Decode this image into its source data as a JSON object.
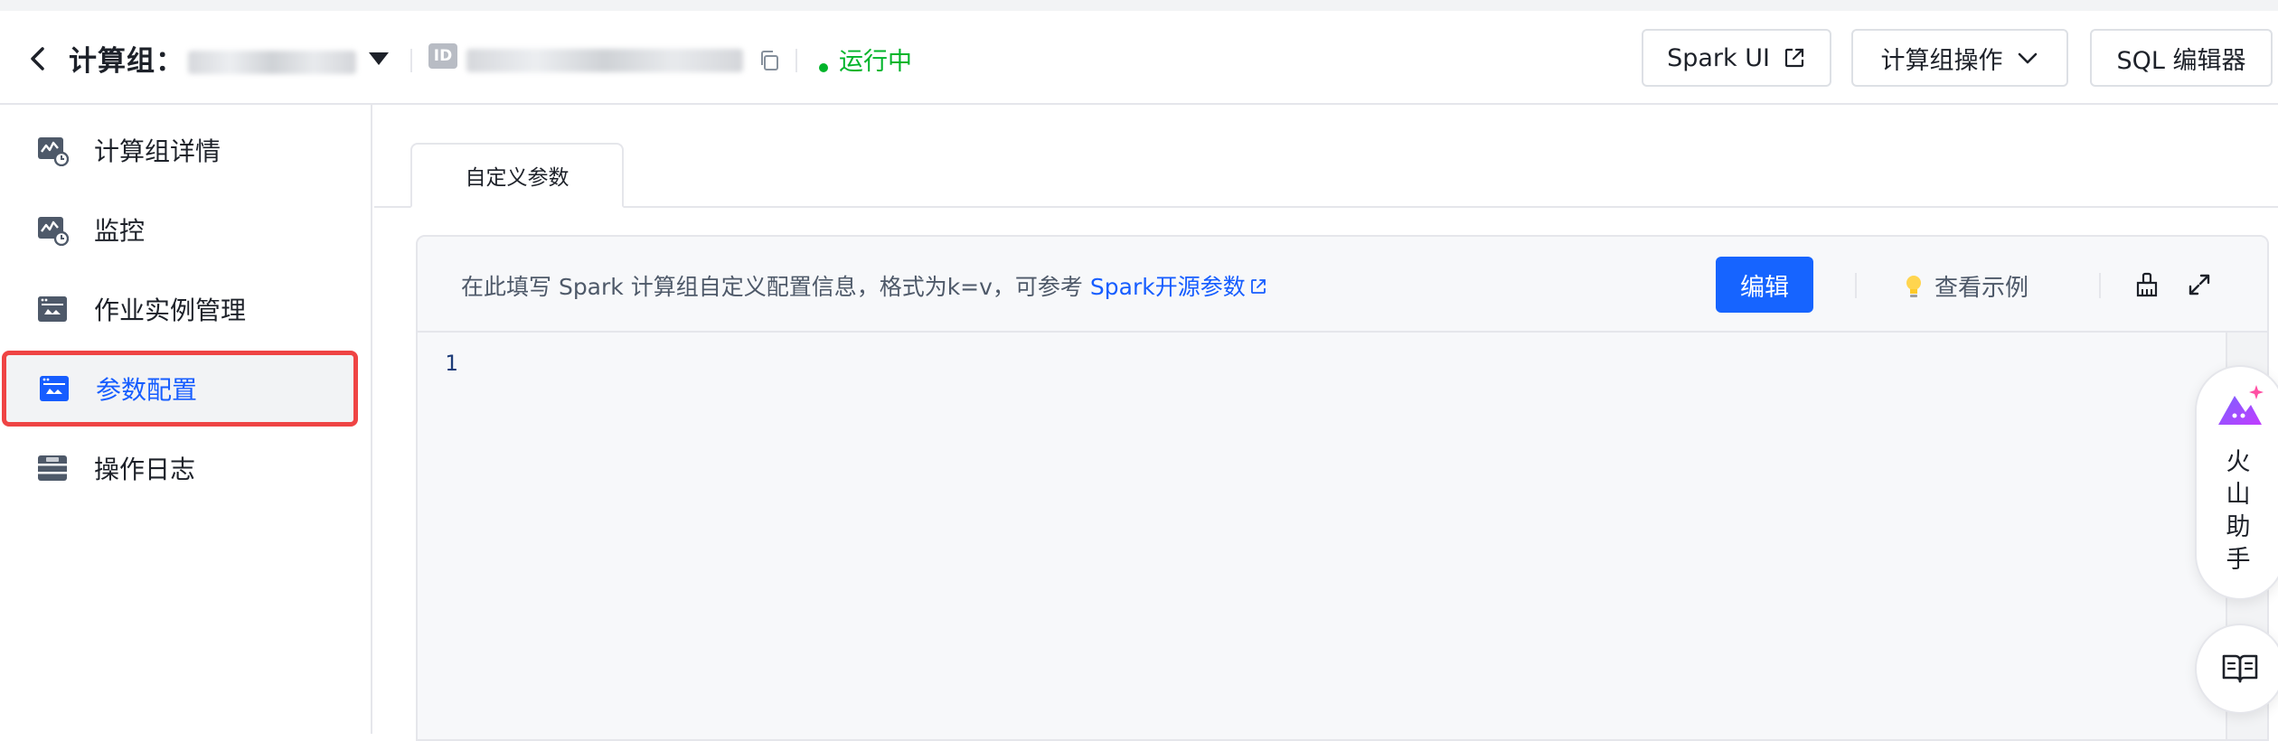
{
  "header": {
    "title": "计算组：",
    "status": "运行中",
    "id_badge": "ID",
    "buttons": {
      "spark_ui": "Spark UI",
      "compute_group_ops": "计算组操作",
      "sql_editor": "SQL 编辑器"
    }
  },
  "sidebar": {
    "items": [
      {
        "label": "计算组详情",
        "icon": "chart-monitor-icon"
      },
      {
        "label": "监控",
        "icon": "chart-monitor-icon"
      },
      {
        "label": "作业实例管理",
        "icon": "job-window-icon"
      },
      {
        "label": "参数配置",
        "icon": "job-window-icon",
        "active": true
      },
      {
        "label": "操作日志",
        "icon": "log-icon"
      }
    ]
  },
  "main": {
    "tabs": [
      {
        "label": "自定义参数",
        "active": true
      }
    ],
    "hint_text": "在此填写 Spark 计算组自定义配置信息，格式为k=v，可参考 ",
    "hint_link": "Spark开源参数",
    "edit_button": "编辑",
    "example_label": "查看示例",
    "editor": {
      "line_numbers": [
        "1"
      ]
    }
  },
  "assistant": {
    "label_lines": [
      "火",
      "山",
      "助",
      "手"
    ]
  },
  "colors": {
    "accent": "#165dff",
    "status_green": "#00b42a",
    "highlight_border": "#ef4444"
  }
}
